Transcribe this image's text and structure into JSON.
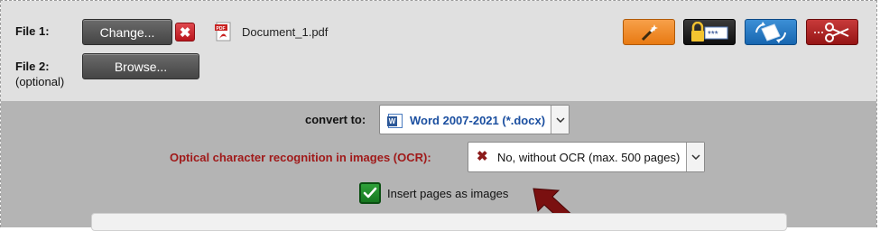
{
  "file1": {
    "label": "File 1:",
    "change_label": "Change...",
    "remove_glyph": "✖",
    "filename": "Document_1.pdf",
    "file_icon": "pdf-file-icon"
  },
  "file2": {
    "label": "File 2:",
    "sub_label": "(optional)",
    "browse_label": "Browse..."
  },
  "toolbar": [
    {
      "name": "magic-wand-icon",
      "color": "#e87a12"
    },
    {
      "name": "password-lock-icon",
      "color": "#111111"
    },
    {
      "name": "rotate-page-icon",
      "color": "#1766b0"
    },
    {
      "name": "scissors-icon",
      "color": "#951515"
    }
  ],
  "convert": {
    "label": "convert to:",
    "selected": "Word 2007-2021 (*.docx)",
    "icon": "word-doc-icon"
  },
  "ocr": {
    "label": "Optical character recognition in images (OCR):",
    "selected": "No, without OCR (max. 500 pages)",
    "icon_glyph": "✖"
  },
  "insert_images": {
    "label": "Insert pages as images",
    "checked": true
  },
  "colors": {
    "ocr_label": "#a01a1a",
    "convert_value": "#1b4fa0",
    "checkbox": "#16771f",
    "arrow": "#7a1010"
  }
}
